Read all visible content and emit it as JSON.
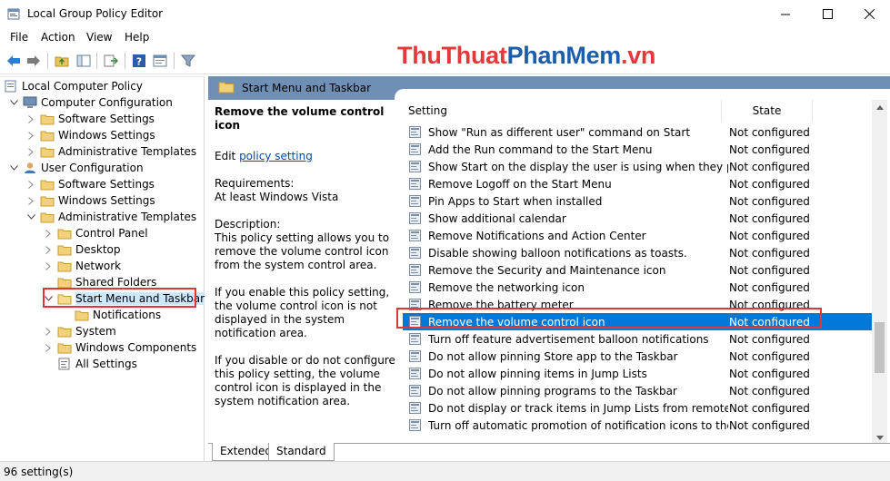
{
  "window": {
    "title": "Local Group Policy Editor",
    "controls": [
      "minimize",
      "maximize",
      "close"
    ]
  },
  "menu": [
    "File",
    "Action",
    "View",
    "Help"
  ],
  "toolbar": {
    "icons": [
      "back-icon",
      "forward-icon",
      "up-folder-icon",
      "show-hide-tree-icon",
      "export-list-icon",
      "help-icon",
      "properties-icon",
      "filter-icon"
    ]
  },
  "watermark": {
    "red_part": "ThuThuat",
    "blue_part": "PhanMem",
    "red_tail": ".vn"
  },
  "tree": {
    "nodes": [
      {
        "label": "Local Computer Policy",
        "level": 0,
        "icon": "policy-computer-icon",
        "expander": ""
      },
      {
        "label": "Computer Configuration",
        "level": 1,
        "icon": "computer-icon",
        "expander": "open"
      },
      {
        "label": "Software Settings",
        "level": 2,
        "icon": "folder-icon",
        "expander": "closed"
      },
      {
        "label": "Windows Settings",
        "level": 2,
        "icon": "folder-icon",
        "expander": "closed"
      },
      {
        "label": "Administrative Templates",
        "level": 2,
        "icon": "folder-icon",
        "expander": "closed"
      },
      {
        "label": "User Configuration",
        "level": 1,
        "icon": "user-icon",
        "expander": "open"
      },
      {
        "label": "Software Settings",
        "level": 2,
        "icon": "folder-icon",
        "expander": "closed"
      },
      {
        "label": "Windows Settings",
        "level": 2,
        "icon": "folder-icon",
        "expander": "closed"
      },
      {
        "label": "Administrative Templates",
        "level": 2,
        "icon": "folder-icon",
        "expander": "open"
      },
      {
        "label": "Control Panel",
        "level": 3,
        "icon": "folder-icon",
        "expander": "closed"
      },
      {
        "label": "Desktop",
        "level": 3,
        "icon": "folder-icon",
        "expander": "closed"
      },
      {
        "label": "Network",
        "level": 3,
        "icon": "folder-icon",
        "expander": "closed"
      },
      {
        "label": "Shared Folders",
        "level": 3,
        "icon": "folder-icon",
        "expander": ""
      },
      {
        "label": "Start Menu and Taskbar",
        "level": 3,
        "icon": "folder-open-icon",
        "expander": "open",
        "selected": true
      },
      {
        "label": "Notifications",
        "level": 4,
        "icon": "folder-icon",
        "expander": ""
      },
      {
        "label": "System",
        "level": 3,
        "icon": "folder-icon",
        "expander": "closed"
      },
      {
        "label": "Windows Components",
        "level": 3,
        "icon": "folder-icon",
        "expander": "closed"
      },
      {
        "label": "All Settings",
        "level": 3,
        "icon": "all-settings-icon",
        "expander": ""
      }
    ]
  },
  "panel": {
    "title": "Start Menu and Taskbar",
    "description": {
      "setting_title": "Remove the volume control icon",
      "edit_prefix": "Edit ",
      "edit_link": "policy setting",
      "requirements_label": "Requirements:",
      "requirements_value": "At least Windows Vista",
      "description_label": "Description:",
      "description_text": "This policy setting allows you to remove the volume control icon from the system control area.",
      "enabled_text": "If you enable this policy setting, the volume control icon is not displayed in the system notification area.",
      "disabled_text": "If you disable or do not configure this policy setting, the volume control icon is displayed in the system notification area."
    },
    "columns": {
      "setting": "Setting",
      "state": "State"
    },
    "rows": [
      {
        "name": "Show \"Run as different user\" command on Start",
        "state": "Not configured"
      },
      {
        "name": "Add the Run command to the Start Menu",
        "state": "Not configured"
      },
      {
        "name": "Show Start on the display the user is using when they press t...",
        "state": "Not configured"
      },
      {
        "name": "Remove Logoff on the Start Menu",
        "state": "Not configured"
      },
      {
        "name": "Pin Apps to Start when installed",
        "state": "Not configured"
      },
      {
        "name": "Show additional calendar",
        "state": "Not configured"
      },
      {
        "name": "Remove Notifications and Action Center",
        "state": "Not configured"
      },
      {
        "name": "Disable showing balloon notifications as toasts.",
        "state": "Not configured"
      },
      {
        "name": "Remove the Security and Maintenance icon",
        "state": "Not configured"
      },
      {
        "name": "Remove the networking icon",
        "state": "Not configured"
      },
      {
        "name": "Remove the battery meter",
        "state": "Not configured"
      },
      {
        "name": "Remove the volume control icon",
        "state": "Not configured",
        "selected": true
      },
      {
        "name": "Turn off feature advertisement balloon notifications",
        "state": "Not configured"
      },
      {
        "name": "Do not allow pinning Store app to the Taskbar",
        "state": "Not configured"
      },
      {
        "name": "Do not allow pinning items in Jump Lists",
        "state": "Not configured"
      },
      {
        "name": "Do not allow pinning programs to the Taskbar",
        "state": "Not configured"
      },
      {
        "name": "Do not display or track items in Jump Lists from remote loca...",
        "state": "Not configured"
      },
      {
        "name": "Turn off automatic promotion of notification icons to the ta...",
        "state": "Not configured"
      }
    ],
    "tabs": [
      "Extended",
      "Standard"
    ]
  },
  "status": "96 setting(s)",
  "colors": {
    "selection": "#0078d7",
    "highlight": "#e0353b",
    "panel_header": "#6f8fb5"
  }
}
